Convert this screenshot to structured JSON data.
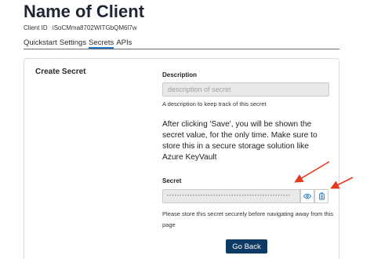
{
  "header": {
    "title": "Name of Client",
    "client_id_label": "Client ID",
    "client_id_value": "iSoCMma8702WITGbQM6l7w"
  },
  "tabs": [
    {
      "label": "Quickstart",
      "active": false
    },
    {
      "label": "Settings",
      "active": false
    },
    {
      "label": "Secrets",
      "active": true
    },
    {
      "label": "APIs",
      "active": false
    }
  ],
  "card": {
    "title": "Create Secret",
    "description_label": "Description",
    "description_placeholder": "description of secret",
    "description_value": "",
    "description_help": "A description to keep track of this secret",
    "notice": "After clicking 'Save', you will be shown the secret value, for the only time. Make sure to store this in a secure storage solution like Azure KeyVault",
    "secret_label": "Secret",
    "secret_masked": "••••••••••••••••••••••••••••••••••••••••••••••••",
    "secret_help": "Please store this secret securely before navigating away from this page",
    "go_back_label": "Go Back"
  },
  "icons": {
    "reveal": "eye-icon",
    "copy": "copy-icon"
  },
  "colors": {
    "accent": "#1f78c1",
    "primary_button": "#0d3a63",
    "annotation_arrow": "#e53a1f"
  }
}
